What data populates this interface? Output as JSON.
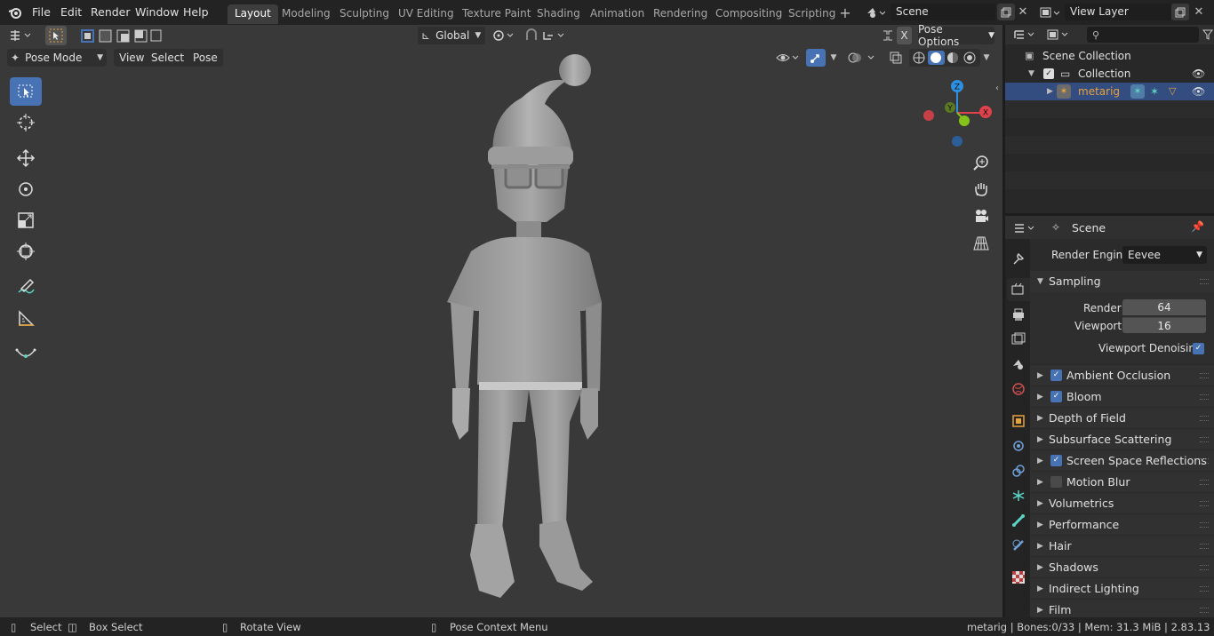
{
  "topbar": {
    "menus": [
      "File",
      "Edit",
      "Render",
      "Window",
      "Help"
    ],
    "workspaces": [
      "Layout",
      "Modeling",
      "Sculpting",
      "UV Editing",
      "Texture Paint",
      "Shading",
      "Animation",
      "Rendering",
      "Compositing",
      "Scripting"
    ],
    "active_workspace": "Layout",
    "scene_name": "Scene",
    "view_layer": "View Layer"
  },
  "viewport_header": {
    "transform_orientation": "Global",
    "pose_options": "Pose Options",
    "x_mirror": "X",
    "mode": "Pose Mode",
    "menus": [
      "View",
      "Select",
      "Pose"
    ]
  },
  "outliner": {
    "scene_collection": "Scene Collection",
    "collection": "Collection",
    "object": "metarig"
  },
  "properties": {
    "header": "Scene",
    "render_engine_label": "Render Engine",
    "render_engine": "Eevee",
    "sampling": {
      "title": "Sampling",
      "render_label": "Render",
      "render_value": "64",
      "viewport_label": "Viewport",
      "viewport_value": "16",
      "denoise_label": "Viewport Denoising"
    },
    "panels": [
      {
        "label": "Ambient Occlusion",
        "checkbox": true,
        "checked": true
      },
      {
        "label": "Bloom",
        "checkbox": true,
        "checked": true
      },
      {
        "label": "Depth of Field",
        "checkbox": false
      },
      {
        "label": "Subsurface Scattering",
        "checkbox": false
      },
      {
        "label": "Screen Space Reflections",
        "checkbox": true,
        "checked": true
      },
      {
        "label": "Motion Blur",
        "checkbox": true,
        "checked": false
      },
      {
        "label": "Volumetrics",
        "checkbox": false
      },
      {
        "label": "Performance",
        "checkbox": false
      },
      {
        "label": "Hair",
        "checkbox": false
      },
      {
        "label": "Shadows",
        "checkbox": false
      },
      {
        "label": "Indirect Lighting",
        "checkbox": false
      },
      {
        "label": "Film",
        "checkbox": false
      }
    ]
  },
  "statusbar": {
    "select": "Select",
    "box_select": "Box Select",
    "rotate_view": "Rotate View",
    "context_menu": "Pose Context Menu",
    "info": "metarig | Bones:0/33 | Mem: 31.3 MiB | 2.83.13"
  },
  "gizmo": {
    "x": "X",
    "y": "Y",
    "z": "Z"
  },
  "colors": {
    "accent": "#4772b3",
    "x_axis": "#e0424b",
    "y_axis": "#84c21a",
    "z_axis": "#2c8fdf",
    "object_orange": "#e8a23c"
  }
}
